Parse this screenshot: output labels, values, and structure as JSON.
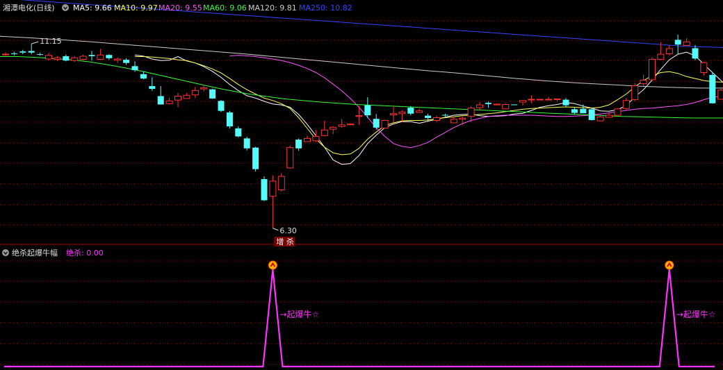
{
  "main_panel": {
    "title": "湘潭电化(日线)",
    "indicators": [
      {
        "label": "MA5: 9.66",
        "color": "#ffffff"
      },
      {
        "label": "MA10: 9.97",
        "color": "#ffff55"
      },
      {
        "label": "MA20: 9.55",
        "color": "#ff55ff"
      },
      {
        "label": "MA60: 9.06",
        "color": "#33ff33"
      },
      {
        "label": "MA120: 9.81",
        "color": "#cccccc"
      },
      {
        "label": "MA250: 10.82",
        "color": "#3344ff"
      }
    ],
    "high_label": "11.15",
    "low_label": "6.30",
    "signal_label": "增 杀",
    "ylim": [
      6.0,
      11.6
    ]
  },
  "sub_panel": {
    "title": "绝杀起爆牛幅",
    "value_label": "绝杀: 0.00",
    "signal_text": "→起爆牛☆",
    "line_color": "#ff33ff"
  },
  "colors": {
    "up": "#ff3333",
    "down": "#54fcfc",
    "grid": "#8b0000",
    "background": "#000000"
  },
  "chart_data": [
    {
      "type": "candlestick",
      "title": "湘潭电化(日线)",
      "ylim": [
        6.0,
        11.6
      ],
      "candles": [
        [
          10.66,
          10.7,
          10.62,
          10.66
        ],
        [
          10.68,
          10.72,
          10.63,
          10.66
        ],
        [
          10.73,
          10.77,
          10.66,
          10.7
        ],
        [
          10.74,
          10.92,
          10.66,
          10.7
        ],
        [
          10.66,
          10.7,
          10.62,
          10.65
        ],
        [
          10.54,
          10.69,
          10.5,
          10.63
        ],
        [
          10.53,
          10.61,
          10.49,
          10.57
        ],
        [
          10.61,
          10.65,
          10.48,
          10.5
        ],
        [
          10.5,
          10.61,
          10.47,
          10.57
        ],
        [
          10.53,
          10.65,
          10.51,
          10.61
        ],
        [
          10.64,
          10.74,
          10.5,
          10.61
        ],
        [
          10.53,
          10.79,
          10.52,
          10.64
        ],
        [
          10.64,
          10.66,
          10.52,
          10.56
        ],
        [
          10.51,
          10.58,
          10.44,
          10.54
        ],
        [
          10.52,
          10.56,
          10.39,
          10.44
        ],
        [
          10.36,
          10.48,
          10.22,
          10.26
        ],
        [
          10.16,
          10.23,
          10.03,
          10.05
        ],
        [
          9.86,
          10.08,
          9.74,
          9.79
        ],
        [
          9.61,
          9.86,
          9.4,
          9.4
        ],
        [
          9.42,
          9.57,
          9.4,
          9.49
        ],
        [
          9.51,
          9.69,
          9.34,
          9.61
        ],
        [
          9.55,
          9.69,
          9.54,
          9.63
        ],
        [
          9.64,
          9.84,
          9.56,
          9.75
        ],
        [
          9.79,
          9.89,
          9.73,
          9.82
        ],
        [
          9.78,
          9.8,
          9.54,
          9.55
        ],
        [
          9.49,
          9.51,
          9.21,
          9.24
        ],
        [
          9.2,
          9.24,
          8.8,
          8.85
        ],
        [
          8.8,
          8.85,
          8.58,
          8.6
        ],
        [
          8.55,
          8.59,
          8.25,
          8.3
        ],
        [
          8.32,
          8.34,
          7.72,
          7.78
        ],
        [
          7.53,
          7.6,
          6.98,
          7.0
        ],
        [
          7.1,
          7.62,
          6.3,
          7.48
        ],
        [
          7.26,
          7.68,
          7.22,
          7.6
        ],
        [
          7.81,
          8.37,
          7.79,
          8.32
        ],
        [
          8.52,
          8.55,
          8.24,
          8.3
        ],
        [
          8.47,
          8.62,
          8.46,
          8.55
        ],
        [
          8.49,
          8.76,
          8.46,
          8.6
        ],
        [
          8.62,
          8.99,
          8.6,
          8.76
        ],
        [
          8.78,
          8.86,
          8.66,
          8.83
        ],
        [
          8.85,
          9.04,
          8.82,
          8.89
        ],
        [
          8.89,
          8.93,
          8.89,
          8.91
        ],
        [
          9.1,
          9.36,
          8.89,
          9.12
        ],
        [
          9.38,
          9.58,
          9.06,
          9.13
        ],
        [
          9.04,
          9.16,
          8.77,
          8.82
        ],
        [
          8.81,
          9.02,
          8.8,
          9.0
        ],
        [
          9.14,
          9.36,
          8.95,
          9.17
        ],
        [
          9.17,
          9.25,
          8.96,
          9.21
        ],
        [
          9.32,
          9.36,
          9.13,
          9.17
        ],
        [
          9.2,
          9.3,
          9.2,
          9.24
        ],
        [
          9.12,
          9.17,
          8.99,
          9.06
        ],
        [
          9.0,
          9.12,
          8.96,
          9.07
        ],
        [
          9.14,
          9.17,
          9.1,
          9.13
        ],
        [
          8.94,
          9.09,
          8.94,
          9.03
        ],
        [
          9.03,
          9.1,
          8.88,
          9.06
        ],
        [
          9.1,
          9.35,
          8.96,
          9.31
        ],
        [
          9.32,
          9.46,
          9.25,
          9.39
        ],
        [
          9.44,
          9.47,
          9.32,
          9.41
        ],
        [
          9.39,
          9.42,
          9.38,
          9.41
        ],
        [
          9.29,
          9.42,
          9.29,
          9.4
        ],
        [
          9.4,
          9.4,
          9.38,
          9.39
        ],
        [
          9.46,
          9.48,
          9.37,
          9.5
        ],
        [
          9.52,
          9.63,
          9.43,
          9.53
        ],
        [
          9.53,
          9.54,
          9.51,
          9.53
        ],
        [
          9.53,
          9.59,
          9.52,
          9.53
        ],
        [
          9.53,
          9.55,
          9.47,
          9.54
        ],
        [
          9.52,
          9.56,
          9.34,
          9.38
        ],
        [
          9.28,
          9.33,
          9.15,
          9.19
        ],
        [
          9.29,
          9.4,
          9.18,
          9.18
        ],
        [
          9.28,
          9.31,
          9.0,
          9.01
        ],
        [
          8.99,
          9.14,
          8.98,
          9.09
        ],
        [
          9.08,
          9.18,
          9.06,
          9.13
        ],
        [
          9.13,
          9.3,
          9.12,
          9.29
        ],
        [
          9.3,
          9.56,
          9.26,
          9.5
        ],
        [
          9.52,
          9.94,
          9.49,
          9.87
        ],
        [
          9.92,
          10.15,
          9.87,
          10.01
        ],
        [
          10.02,
          10.58,
          9.98,
          10.53
        ],
        [
          10.53,
          10.96,
          10.51,
          10.66
        ],
        [
          10.67,
          10.88,
          10.63,
          10.8
        ],
        [
          11.02,
          11.15,
          10.66,
          10.9
        ],
        [
          10.88,
          11.06,
          10.87,
          10.97
        ],
        [
          10.81,
          10.89,
          10.51,
          10.55
        ],
        [
          10.2,
          10.47,
          10.12,
          10.45
        ],
        [
          10.14,
          10.21,
          9.42,
          9.43
        ],
        [
          9.53,
          9.81,
          9.53,
          9.76
        ],
        [
          9.72,
          9.86,
          9.51,
          9.86
        ]
      ],
      "series": [
        {
          "name": "MA5",
          "values": [
            10.64,
            10.61,
            10.54,
            10.5,
            10.51,
            10.6,
            10.49,
            10.44,
            10.35,
            10.23,
            10.08,
            9.9,
            9.75,
            9.62,
            9.56,
            9.48,
            9.41,
            9.39,
            9.33,
            9.15,
            8.9,
            8.62,
            8.33,
            8.01,
            7.9,
            7.92,
            8.12,
            8.42,
            8.63,
            8.82,
            8.91,
            8.97,
            8.97,
            8.93,
            8.98,
            9.03,
            9.08,
            9.13,
            9.15,
            9.16,
            9.12,
            9.1,
            9.11,
            9.12,
            9.16,
            9.18,
            9.25,
            9.33,
            9.37,
            9.4,
            9.45,
            9.42,
            9.36,
            9.31,
            9.24,
            9.23,
            9.27,
            9.37,
            9.59,
            9.77,
            10.01,
            10.28,
            10.52,
            10.66,
            10.71,
            10.62,
            10.41,
            10.2,
            10.0,
            9.8
          ]
        },
        {
          "name": "MA10",
          "values": [
            10.6,
            10.6,
            10.59,
            10.57,
            10.55,
            10.52,
            10.5,
            10.44,
            10.37,
            10.29,
            10.19,
            10.05,
            9.9,
            9.77,
            9.66,
            9.56,
            9.5,
            9.42,
            9.3,
            9.07,
            8.8,
            8.53,
            8.33,
            8.19,
            8.14,
            8.16,
            8.3,
            8.53,
            8.71,
            8.87,
            8.94,
            8.99,
            9.0,
            9.0,
            9.01,
            9.04,
            9.07,
            9.09,
            9.12,
            9.13,
            9.15,
            9.17,
            9.19,
            9.22,
            9.25,
            9.28,
            9.3,
            9.31,
            9.32,
            9.33,
            9.34,
            9.33,
            9.32,
            9.31,
            9.33,
            9.39,
            9.52,
            9.66,
            9.84,
            10.0,
            10.12,
            10.2,
            10.22,
            10.18,
            10.1,
            10.05,
            10.0,
            9.97,
            9.96,
            9.97
          ]
        },
        {
          "name": "MA20",
          "values": [
            10.62,
            10.63,
            10.62,
            10.6,
            10.57,
            10.54,
            10.5,
            10.45,
            10.38,
            10.3,
            10.2,
            10.07,
            9.91,
            9.74,
            9.55,
            9.33,
            9.08,
            8.82,
            8.6,
            8.42,
            8.35,
            8.32,
            8.37,
            8.45,
            8.58,
            8.7,
            8.82,
            8.92,
            9.0,
            9.05,
            9.1,
            9.12,
            9.13,
            9.13,
            9.13,
            9.13,
            9.12,
            9.11,
            9.1,
            9.1,
            9.11,
            9.12,
            9.14,
            9.16,
            9.19,
            9.22,
            9.25,
            9.28,
            9.3,
            9.31,
            9.33,
            9.35,
            9.37,
            9.4,
            9.45,
            9.52,
            9.58,
            9.6,
            9.55
          ]
        },
        {
          "name": "MA60",
          "values": [
            10.6,
            10.6,
            10.58,
            10.55,
            10.52,
            10.47,
            10.4,
            10.32,
            10.23,
            10.13,
            10.03,
            9.93,
            9.83,
            9.74,
            9.66,
            9.6,
            9.54,
            9.5,
            9.46,
            9.43,
            9.4,
            9.38,
            9.36,
            9.34,
            9.32,
            9.3,
            9.28,
            9.26,
            9.24,
            9.22,
            9.2,
            9.18,
            9.16,
            9.14,
            9.12,
            9.1,
            9.09,
            9.08,
            9.07,
            9.06,
            9.06,
            9.06
          ]
        },
        {
          "name": "MA120",
          "values": [
            11.11,
            11.07,
            11.02,
            10.97,
            10.91,
            10.85,
            10.79,
            10.73,
            10.67,
            10.6,
            10.53,
            10.46,
            10.39,
            10.32,
            10.25,
            10.19,
            10.12,
            10.05,
            9.99,
            9.94,
            9.9,
            9.86,
            9.83,
            9.81,
            9.81
          ]
        },
        {
          "name": "MA250",
          "values": [
            12.06,
            11.98,
            11.9,
            11.82,
            11.74,
            11.66,
            11.58,
            11.5,
            11.42,
            11.34,
            11.26,
            11.18,
            11.1,
            11.02,
            10.94,
            10.86,
            10.82
          ]
        }
      ]
    },
    {
      "type": "line",
      "title": "绝杀起爆牛幅",
      "series": [
        {
          "name": "绝杀",
          "values": [
            0,
            0,
            0,
            0,
            0,
            0,
            0,
            0,
            0,
            0,
            0,
            0,
            0,
            0,
            0,
            0,
            0,
            0,
            0,
            0,
            0,
            0,
            0,
            0,
            0,
            0,
            0,
            0,
            0,
            0,
            0,
            1,
            0,
            0,
            0,
            0,
            0,
            0,
            0,
            0,
            0,
            0,
            0,
            0,
            0,
            0,
            0,
            0,
            0,
            0,
            0,
            0,
            0,
            0,
            0,
            0,
            0,
            0,
            0,
            0,
            0,
            0,
            0,
            0,
            0,
            0,
            0,
            0,
            0,
            0,
            0,
            0,
            0,
            0,
            0,
            0,
            0,
            1,
            0,
            0,
            0,
            0,
            0,
            0,
            0
          ]
        }
      ],
      "ylim": [
        0,
        1
      ]
    }
  ]
}
